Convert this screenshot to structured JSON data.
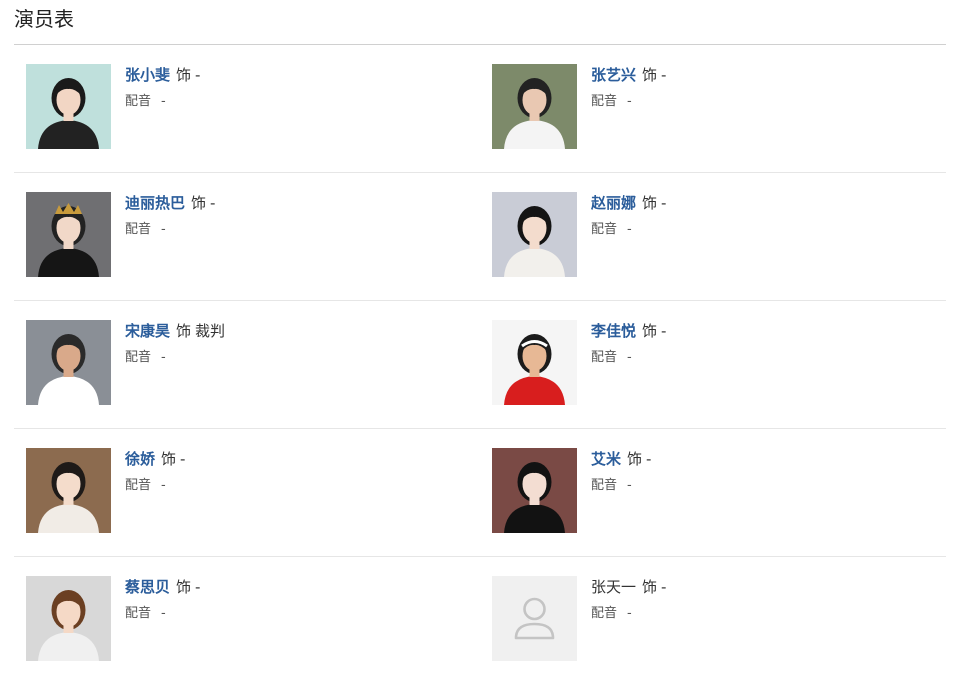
{
  "section": {
    "title": "演员表"
  },
  "role_word": "饰",
  "voice_label": "配音",
  "rows": [
    [
      {
        "name": "张小斐",
        "role": "-",
        "voice": "-",
        "linked": true,
        "photo": "portrait",
        "bg": "#bfe0dc",
        "clothes": "#222222",
        "hair": "#1a1a1a",
        "skin": "#f2d6c4"
      },
      {
        "name": "张艺兴",
        "role": "-",
        "voice": "-",
        "linked": true,
        "photo": "portrait",
        "bg": "#7d8a6a",
        "clothes": "#f4f4f4",
        "hair": "#222222",
        "skin": "#e9c8b2"
      }
    ],
    [
      {
        "name": "迪丽热巴",
        "role": "-",
        "voice": "-",
        "linked": true,
        "photo": "portrait",
        "bg": "#6f6f72",
        "clothes": "#151515",
        "hair": "#222222",
        "skin": "#f1d8c8",
        "crown": "#c89b3c"
      },
      {
        "name": "赵丽娜",
        "role": "-",
        "voice": "-",
        "linked": true,
        "photo": "portrait",
        "bg": "#c9ccd6",
        "clothes": "#f2f0ec",
        "hair": "#141414",
        "skin": "#f3dccd"
      }
    ],
    [
      {
        "name": "宋康昊",
        "role": "裁判",
        "voice": "-",
        "linked": true,
        "photo": "portrait",
        "bg": "#8a8f96",
        "clothes": "#ffffff",
        "hair": "#2a2a2a",
        "skin": "#d9a98a"
      },
      {
        "name": "李佳悦",
        "role": "-",
        "voice": "-",
        "linked": true,
        "photo": "portrait",
        "bg": "#f5f5f5",
        "clothes": "#d81e1e",
        "hair": "#1b1b1b",
        "skin": "#e7b895",
        "headband": "#ffffff"
      }
    ],
    [
      {
        "name": "徐娇",
        "role": "-",
        "voice": "-",
        "linked": true,
        "photo": "portrait",
        "bg": "#8c6b4f",
        "clothes": "#f1ece6",
        "hair": "#1e1a18",
        "skin": "#f4dccb"
      },
      {
        "name": "艾米",
        "role": "-",
        "voice": "-",
        "linked": true,
        "photo": "portrait",
        "bg": "#7a4a45",
        "clothes": "#121212",
        "hair": "#121212",
        "skin": "#f3ddd2"
      }
    ],
    [
      {
        "name": "蔡思贝",
        "role": "-",
        "voice": "-",
        "linked": true,
        "photo": "portrait",
        "bg": "#d8d8d8",
        "clothes": "#f0f0f0",
        "hair": "#6b3f22",
        "skin": "#f5d9c6"
      },
      {
        "name": "张天一",
        "role": "-",
        "voice": "-",
        "linked": false,
        "photo": "placeholder",
        "bg": "#f0f0f0",
        "icon": "user-placeholder-icon"
      }
    ]
  ]
}
